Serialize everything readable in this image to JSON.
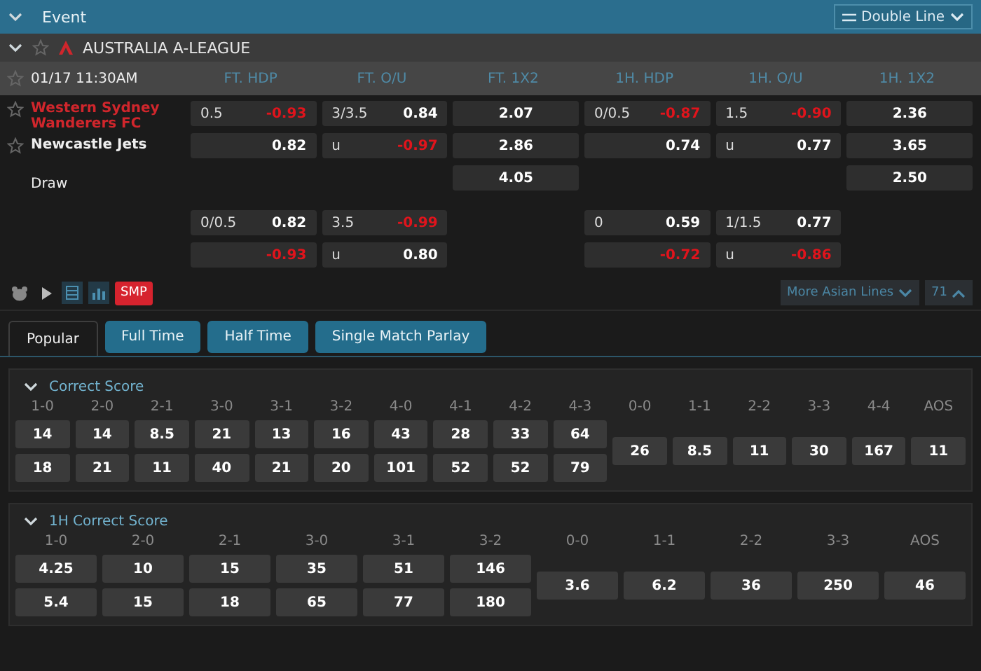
{
  "header": {
    "title": "Event",
    "expanded": true,
    "view_select": {
      "label": "Double Line"
    }
  },
  "league": {
    "name": "AUSTRALIA A-LEAGUE",
    "expanded": true
  },
  "match": {
    "time": "01/17 11:30AM",
    "teams": [
      {
        "name": "Western Sydney Wanderers FC",
        "highlighted": true,
        "star": true
      },
      {
        "name": "Newcastle Jets",
        "highlighted": false,
        "star": true
      },
      {
        "name": "Draw",
        "highlighted": false,
        "star": false
      }
    ],
    "columns": [
      {
        "header": "FT. HDP",
        "kind": "line",
        "blocks": [
          [
            {
              "line": "0.5",
              "price": "-0.93",
              "negative": true
            },
            {
              "price": "0.82",
              "negative": false
            }
          ],
          [
            {
              "line": "0/0.5",
              "price": "0.82",
              "negative": false
            },
            {
              "price": "-0.93",
              "negative": true
            }
          ]
        ]
      },
      {
        "header": "FT. O/U",
        "kind": "line",
        "blocks": [
          [
            {
              "line": "3/3.5",
              "price": "0.84",
              "negative": false
            },
            {
              "line": "u",
              "price": "-0.97",
              "negative": true
            }
          ],
          [
            {
              "line": "3.5",
              "price": "-0.99",
              "negative": true
            },
            {
              "line": "u",
              "price": "0.80",
              "negative": false
            }
          ]
        ]
      },
      {
        "header": "FT. 1X2",
        "kind": "price",
        "blocks": [
          [
            {
              "price": "2.07",
              "negative": false
            },
            {
              "price": "2.86",
              "negative": false
            },
            {
              "price": "4.05",
              "negative": false
            }
          ]
        ]
      },
      {
        "header": "1H. HDP",
        "kind": "line",
        "blocks": [
          [
            {
              "line": "0/0.5",
              "price": "-0.87",
              "negative": true
            },
            {
              "price": "0.74",
              "negative": false
            }
          ],
          [
            {
              "line": "0",
              "price": "0.59",
              "negative": false
            },
            {
              "price": "-0.72",
              "negative": true
            }
          ]
        ]
      },
      {
        "header": "1H. O/U",
        "kind": "line",
        "blocks": [
          [
            {
              "line": "1.5",
              "price": "-0.90",
              "negative": true
            },
            {
              "line": "u",
              "price": "0.77",
              "negative": false
            }
          ],
          [
            {
              "line": "1/1.5",
              "price": "0.77",
              "negative": false
            },
            {
              "line": "u",
              "price": "-0.86",
              "negative": true
            }
          ]
        ]
      },
      {
        "header": "1H. 1X2",
        "kind": "price",
        "blocks": [
          [
            {
              "price": "2.36",
              "negative": false
            },
            {
              "price": "3.65",
              "negative": false
            },
            {
              "price": "2.50",
              "negative": false
            }
          ]
        ]
      }
    ]
  },
  "toolbar": {
    "tools": [
      {
        "kind": "bear",
        "selected": false
      },
      {
        "kind": "play",
        "selected": false
      },
      {
        "kind": "list",
        "selected": true
      },
      {
        "kind": "chart",
        "selected": true
      }
    ],
    "smp": "SMP",
    "more_lines": "More Asian Lines",
    "count": "71"
  },
  "tabs": [
    {
      "label": "Popular",
      "selected": true
    },
    {
      "label": "Full Time",
      "selected": false
    },
    {
      "label": "Half Time",
      "selected": false
    },
    {
      "label": "Single Match Parlay",
      "selected": false
    }
  ],
  "panels": [
    {
      "title": "Correct Score",
      "expanded": true,
      "columns": [
        {
          "label": "1-0",
          "values": [
            "14",
            "18"
          ]
        },
        {
          "label": "2-0",
          "values": [
            "14",
            "21"
          ]
        },
        {
          "label": "2-1",
          "values": [
            "8.5",
            "11"
          ]
        },
        {
          "label": "3-0",
          "values": [
            "21",
            "40"
          ]
        },
        {
          "label": "3-1",
          "values": [
            "13",
            "21"
          ]
        },
        {
          "label": "3-2",
          "values": [
            "16",
            "20"
          ]
        },
        {
          "label": "4-0",
          "values": [
            "43",
            "101"
          ]
        },
        {
          "label": "4-1",
          "values": [
            "28",
            "52"
          ]
        },
        {
          "label": "4-2",
          "values": [
            "33",
            "52"
          ]
        },
        {
          "label": "4-3",
          "values": [
            "64",
            "79"
          ]
        },
        {
          "label": "0-0",
          "values": [
            "26"
          ]
        },
        {
          "label": "1-1",
          "values": [
            "8.5"
          ]
        },
        {
          "label": "2-2",
          "values": [
            "11"
          ]
        },
        {
          "label": "3-3",
          "values": [
            "30"
          ]
        },
        {
          "label": "4-4",
          "values": [
            "167"
          ]
        },
        {
          "label": "AOS",
          "values": [
            "11"
          ]
        }
      ]
    },
    {
      "title": "1H Correct Score",
      "expanded": true,
      "columns": [
        {
          "label": "1-0",
          "values": [
            "4.25",
            "5.4"
          ]
        },
        {
          "label": "2-0",
          "values": [
            "10",
            "15"
          ]
        },
        {
          "label": "2-1",
          "values": [
            "15",
            "18"
          ]
        },
        {
          "label": "3-0",
          "values": [
            "35",
            "65"
          ]
        },
        {
          "label": "3-1",
          "values": [
            "51",
            "77"
          ]
        },
        {
          "label": "3-2",
          "values": [
            "146",
            "180"
          ]
        },
        {
          "label": "0-0",
          "values": [
            "3.6"
          ]
        },
        {
          "label": "1-1",
          "values": [
            "6.2"
          ]
        },
        {
          "label": "2-2",
          "values": [
            "36"
          ]
        },
        {
          "label": "3-3",
          "values": [
            "250"
          ]
        },
        {
          "label": "AOS",
          "values": [
            "46"
          ]
        }
      ]
    }
  ]
}
